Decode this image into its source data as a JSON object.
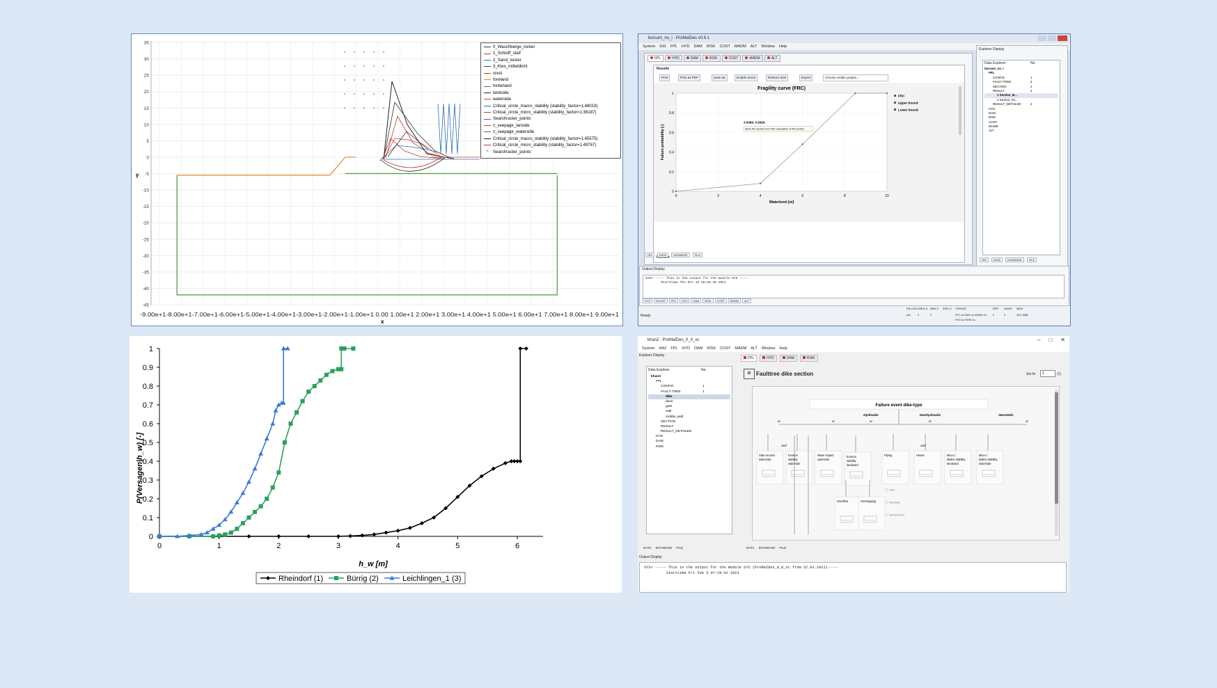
{
  "panel1": {
    "chart_data": {
      "type": "line",
      "xlabel": "x",
      "ylabel": "y",
      "ylim": [
        -45,
        35
      ],
      "yticks": [
        "35",
        "30",
        "25",
        "20",
        "15",
        "10",
        "5",
        "0",
        "-5",
        "-10",
        "-15",
        "-20",
        "-25",
        "-30",
        "-35",
        "-40",
        "-45"
      ],
      "xticks": [
        "-9.00e+1",
        "-8.00e+1",
        "-7.00e+1",
        "-6.00e+1",
        "-5.00e+1",
        "-4.00e+1",
        "-3.00e+1",
        "-2.00e+1",
        "-1.00e+1",
        "0.00",
        "1.00e+1",
        "2.00e+1",
        "3.00e+1",
        "4.00e+1",
        "5.00e+1",
        "6.00e+1",
        "7.00e+1",
        "8.00e+1",
        "9.00e+1"
      ],
      "xtick_label_row": "-9.00e+1-8.00e+1-7.00e+1-6.00e+1-5.00e+1-4.00e+1-3.00e+1-2.00e+1-1.00e+1  0.00   1.00e+1 2.00e+1 3.00e+1 4.00e+1 5.00e+1 6.00e+1 7.00e+1 8.00e+1 9.00e+1",
      "legend": [
        {
          "label": "0_Waschberge_locker",
          "color": "#333333"
        },
        {
          "label": "1_Schluff_steif",
          "color": "#c0392b"
        },
        {
          "label": "2_Sand_locker",
          "color": "#2f6db5"
        },
        {
          "label": "3_Kies_mitteldicht",
          "color": "#444444"
        },
        {
          "label": "crest",
          "color": "#c0392b"
        },
        {
          "label": "foreland",
          "color": "#e08a2e"
        },
        {
          "label": "hinterland",
          "color": "#2f6db5"
        },
        {
          "label": "landside",
          "color": "#222222"
        },
        {
          "label": "waterside",
          "color": "#c0392b"
        },
        {
          "label": "Critical_circle_macro_stability (stability_factor=1.48019)",
          "color": "#2f6db5"
        },
        {
          "label": "Critical_circle_micro_stability (stability_factor=1.36187)",
          "color": "#c0392b"
        },
        {
          "label": "Searchraster_points",
          "color": "#2f6db5"
        },
        {
          "label": "z_seepage_lanside",
          "color": "#c0392b"
        },
        {
          "label": "z_seepage_waterside",
          "color": "#2f6db5"
        },
        {
          "label": "Critical_circle_macro_stability (stability_factor=1.45575)",
          "color": "#222222"
        },
        {
          "label": "Critical_circle_micro_stability (stability_factor=1.49767)",
          "color": "#c0392b"
        },
        {
          "label": "Searchraster_points",
          "color": "#888888",
          "marker": "×"
        }
      ],
      "series": [
        {
          "color": "#e08a2e",
          "x": [
            -82,
            -12,
            -5,
            0
          ],
          "y": [
            -5.5,
            -5.5,
            0,
            0
          ]
        },
        {
          "color": "#4a9a3a",
          "x": [
            -82,
            -82,
            92,
            92
          ],
          "y": [
            -5.5,
            -42,
            -42,
            -5.5
          ]
        },
        {
          "color": "#4a9a3a",
          "x": [
            -5,
            92
          ],
          "y": [
            -5,
            -5
          ]
        }
      ]
    }
  },
  "panel2": {
    "title": "bursum_no_i - ProMaIDes v0.8.1",
    "menu": [
      "System",
      "GIS",
      "FPL",
      "HYD",
      "DAM",
      "RISK",
      "COST",
      "MADM",
      "ALT",
      "Window",
      "Help"
    ],
    "module_tabs": [
      "FPL",
      "HYD",
      "DAM",
      "RISK",
      "COST",
      "MADM",
      "ALT"
    ],
    "results_label": "Results",
    "buttons": [
      "Print",
      "Print as PDF",
      "Save as",
      "Enable Zoom",
      "Restore Size",
      "Export"
    ],
    "graph_select": "Choose visible graphs...",
    "numbers_label": "Number",
    "chart_data": {
      "type": "line",
      "title": "Fragility curve (FRC)",
      "xlabel": "Waterlevel [m]",
      "ylabel": "Failure probability [-]",
      "xlim": [
        0,
        10
      ],
      "ylim": [
        0,
        1
      ],
      "xticks": [
        "0",
        "2",
        "4",
        "6",
        "8",
        "10"
      ],
      "yticks": [
        "0",
        "0.2",
        "0.4",
        "0.6",
        "0.8",
        "1"
      ],
      "legend": [
        "FRC",
        "Upper bound",
        "Lower bound"
      ],
      "series": [
        {
          "name": "FRC",
          "x": [
            0,
            4,
            6,
            8.5,
            10
          ],
          "y": [
            0,
            0.08,
            0.48,
            1,
            1
          ]
        }
      ],
      "annotation": "3.5486, 0.6426",
      "tooltip": "Show the results of an FRC-calculation of this section"
    },
    "explorer_title": "Explorer Display",
    "explorer_header": [
      "Data Explorer",
      "No."
    ],
    "explorer_items": [
      {
        "label": "bursum_no_i",
        "no": ""
      },
      {
        "label": "FPL",
        "no": ""
      },
      {
        "label": "CONFIG",
        "no": "1"
      },
      {
        "label": "FAULT-TREE",
        "no": "5"
      },
      {
        "label": "SECTION",
        "no": "2"
      },
      {
        "label": "RESULT",
        "no": "2"
      },
      {
        "label": "1 Section_B...",
        "no": ""
      },
      {
        "label": "2 Section_Fa...",
        "no": ""
      },
      {
        "label": "RESULT_DETAILED",
        "no": "2"
      },
      {
        "label": "HYD",
        "no": ""
      },
      {
        "label": "DAM",
        "no": ""
      },
      {
        "label": "RISK",
        "no": ""
      },
      {
        "label": "COST",
        "no": ""
      },
      {
        "label": "MADM",
        "no": ""
      },
      {
        "label": "ALT",
        "no": ""
      }
    ],
    "bottom_tabs": [
      "GIS",
      "DATA",
      "DATABASE",
      "FILE"
    ],
    "output_title": "Output Display",
    "output_text_1": "SYS> ----- This is the output for the module SYS -----",
    "output_text_2": "Starttime Thu Oct 16 16:59:40 2014",
    "output_tabs": [
      "SYS",
      "EXCEP",
      "FPL",
      "HYD",
      "DAM",
      "RISK",
      "COST",
      "MADM",
      "ALT"
    ],
    "status_ready": "Ready",
    "status_cols": [
      "DB-CON",
      "AREA-S",
      "MBA-S",
      "RISK-S",
      "THREAD",
      "ERR",
      "WARN",
      "MEM"
    ],
    "status_vals": [
      "yes",
      "0",
      "2",
      "",
      "FPL no   DAM no   MADM no",
      "0",
      "0",
      "28.0 (MB)"
    ],
    "status_vals2": "HYD no   RISK no"
  },
  "panel3": {
    "chart_data": {
      "type": "line",
      "xlabel": "h_w [m]",
      "ylabel": "P(Versagen|h_w) [-]",
      "xlim": [
        0,
        6.5
      ],
      "ylim": [
        0,
        1
      ],
      "xticks": [
        "0",
        "1",
        "2",
        "3",
        "4",
        "5",
        "6"
      ],
      "yticks": [
        "0",
        "0.1",
        "0.2",
        "0.3",
        "0.4",
        "0.5",
        "0.6",
        "0.7",
        "0.8",
        "0.9",
        "1"
      ],
      "series": [
        {
          "name": "Rheindorf (1)",
          "color": "#000000",
          "marker": "diamond",
          "x": [
            0,
            0.5,
            1,
            1.5,
            2,
            2.5,
            3,
            3.2,
            3.4,
            3.6,
            3.8,
            4,
            4.2,
            4.4,
            4.6,
            4.8,
            5,
            5.2,
            5.4,
            5.6,
            5.8,
            5.9,
            5.95,
            6,
            6.05,
            6.05,
            6.15
          ],
          "y": [
            0,
            0,
            0,
            0,
            0,
            0,
            0,
            0.002,
            0.005,
            0.01,
            0.02,
            0.03,
            0.045,
            0.07,
            0.1,
            0.15,
            0.21,
            0.27,
            0.32,
            0.36,
            0.39,
            0.4,
            0.4,
            0.4,
            0.4,
            1,
            1
          ]
        },
        {
          "name": "Bürrig (2)",
          "color": "#2aa05a",
          "marker": "square",
          "x": [
            0,
            0.5,
            0.9,
            1,
            1.1,
            1.2,
            1.3,
            1.4,
            1.5,
            1.6,
            1.7,
            1.8,
            1.9,
            2,
            2.1,
            2.2,
            2.3,
            2.4,
            2.5,
            2.6,
            2.7,
            2.8,
            2.9,
            3,
            3.05,
            3.05,
            3.1,
            3.25
          ],
          "y": [
            0,
            0,
            0,
            0.005,
            0.01,
            0.02,
            0.04,
            0.07,
            0.1,
            0.13,
            0.16,
            0.2,
            0.26,
            0.34,
            0.5,
            0.6,
            0.66,
            0.72,
            0.77,
            0.8,
            0.83,
            0.86,
            0.88,
            0.89,
            0.89,
            1,
            1,
            1
          ]
        },
        {
          "name": "Leichlingen_1 (3)",
          "color": "#3a78d6",
          "marker": "triangle",
          "x": [
            0,
            0.3,
            0.5,
            0.7,
            0.8,
            0.9,
            1,
            1.1,
            1.2,
            1.3,
            1.4,
            1.5,
            1.6,
            1.7,
            1.8,
            1.9,
            1.95,
            2,
            2.05,
            2.08,
            2.08,
            2.15
          ],
          "y": [
            0,
            0,
            0.005,
            0.01,
            0.02,
            0.04,
            0.06,
            0.09,
            0.13,
            0.18,
            0.23,
            0.29,
            0.36,
            0.44,
            0.52,
            0.6,
            0.67,
            0.7,
            0.71,
            0.71,
            1,
            1
          ]
        }
      ],
      "legend": [
        "Rheindorf (1)",
        "Bürrig (2)",
        "Leichlingen_1 (3)"
      ]
    }
  },
  "panel4": {
    "title": "khan2 - ProMaIDes_0_0_vc",
    "menu": [
      "System",
      "HAZ",
      "FPL",
      "HYD",
      "DAM",
      "RISK",
      "COST",
      "MADM",
      "ALT",
      "Window",
      "Help"
    ],
    "explorer_title": "Explorer Display",
    "explorer_header": [
      "Data Explorer",
      "No."
    ],
    "tree": [
      {
        "label": "khan2",
        "no": "",
        "indent": 0
      },
      {
        "label": "FPL",
        "no": "",
        "indent": 1
      },
      {
        "label": "CONFIG",
        "no": "1",
        "indent": 2
      },
      {
        "label": "FAULT-TREE",
        "no": "1",
        "indent": 2
      },
      {
        "label": "dike",
        "no": "",
        "indent": 3
      },
      {
        "label": "dune",
        "no": "",
        "indent": 3
      },
      {
        "label": "gate",
        "no": "",
        "indent": 3
      },
      {
        "label": "wall",
        "no": "",
        "indent": 3
      },
      {
        "label": "mobile_wall",
        "no": "",
        "indent": 3
      },
      {
        "label": "SECTION",
        "no": "",
        "indent": 2
      },
      {
        "label": "RESULT",
        "no": "",
        "indent": 2
      },
      {
        "label": "RESULT_DETAILED",
        "no": "",
        "indent": 2
      },
      {
        "label": "HYD",
        "no": "",
        "indent": 1
      },
      {
        "label": "DAM",
        "no": "",
        "indent": 1
      },
      {
        "label": "RISK",
        "no": "",
        "indent": 1
      }
    ],
    "module_tabs": [
      "FPL",
      "HYD",
      "DAM",
      "RISK"
    ],
    "heading": "Faulttree dike section",
    "set_label": "Set fe:",
    "set_value": "1",
    "set_suffix": "(1)",
    "tree_title": "Failure event dike-type",
    "groups": [
      "Hydraulic",
      "Geohydraulic",
      "Geostatic"
    ],
    "gate_or": "or",
    "gate_and": "and",
    "events": [
      "Start erosion waterside",
      "Erosion stability waterside",
      "Wave impact waterside",
      "Erosion stability landward",
      "Piping",
      "Heave",
      "Micro / Makro-stability landward",
      "Micro / Makro-stability waterside",
      "Overflow",
      "Overtopping"
    ],
    "piping_opts": [
      "Lane",
      "Sellmeijer",
      "Schmertmann"
    ],
    "bottom_tabs_left": [
      "DATA",
      "DATABASE",
      "FILE"
    ],
    "bottom_tabs_right": [
      "DATA",
      "DATABASE",
      "FILE"
    ],
    "output_title": "Output Display",
    "output_text_1": "SYS> ----- This is the output for the module SYS (ProMaIDes_0_0_vc from 22.01.2021)-----",
    "output_text_2": "Starttime Fri Feb  5 07:29:42 2021"
  }
}
